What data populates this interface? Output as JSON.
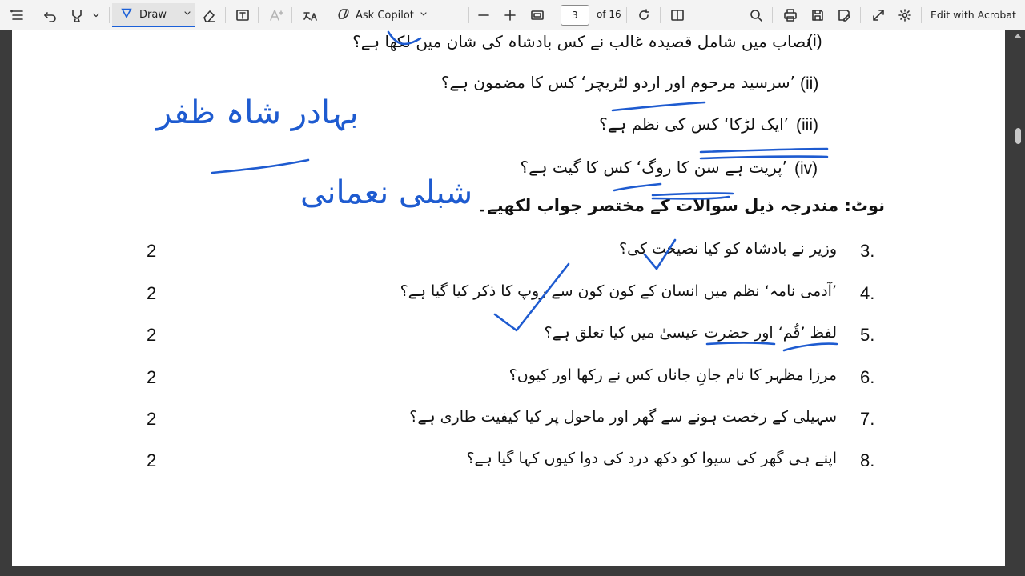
{
  "toolbar": {
    "draw_label": "Draw",
    "copilot_label": "Ask Copilot",
    "page_current": "3",
    "page_total": "of 16",
    "edit_label": "Edit with Acrobat"
  },
  "document": {
    "roman_items": [
      {
        "label": "(i)",
        "text": "نصاب میں شامل قصیدہ غالب نے کس بادشاہ کی شان میں لکھا ہے؟"
      },
      {
        "label": "(ii)",
        "text": "’سرسید مرحوم اور اردو لٹریچر‘ کس کا مضمون ہے؟"
      },
      {
        "label": "(iii)",
        "text": "’ایک لڑکا‘ کس کی نظم ہے؟"
      },
      {
        "label": "(iv)",
        "text": "’پریت ہے سن کا روگ‘ کس کا گیت ہے؟"
      }
    ],
    "note": "نوٹ: مندرجہ ذیل سوالات کے مختصر جواب لکھیے۔",
    "questions": [
      {
        "number": "3.",
        "text": "وزیر نے بادشاہ کو کیا نصیحت کی؟",
        "marks": "2"
      },
      {
        "number": "4.",
        "text": "’آدمی نامہ‘ نظم میں انسان کے کون کون سے روپ کا ذکر کیا گیا ہے؟",
        "marks": "2"
      },
      {
        "number": "5.",
        "text": "لفظ ’قُم‘ اور حضرت عیسیٰ میں کیا تعلق ہے؟",
        "marks": "2"
      },
      {
        "number": "6.",
        "text": "مرزا مظہر کا نام جانِ جاناں کس نے رکھا اور کیوں؟",
        "marks": "2"
      },
      {
        "number": "7.",
        "text": "سہیلی کے رخصت ہونے سے گھر اور ماحول پر کیا کیفیت طاری ہے؟",
        "marks": "2"
      },
      {
        "number": "8.",
        "text": "اپنے ہی گھر کی سیوا کو دکھ درد کی دوا کیوں کہا گیا ہے؟",
        "marks": "2"
      }
    ]
  },
  "handwriting": {
    "note_1": "بہادر شاہ ظفر",
    "note_2": "شبلی نعمانی"
  },
  "colors": {
    "ink": "#1e5bd0",
    "toolbar_bg": "#f3f3f3",
    "viewer_bg": "#3b3b3b",
    "accent": "#1a5fd8"
  }
}
